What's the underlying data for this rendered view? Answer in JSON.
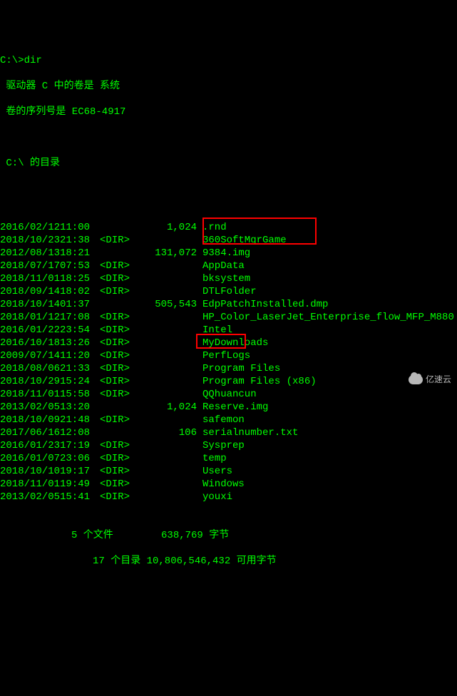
{
  "prompt": "C:\\>dir",
  "volume_line": " 驱动器 C 中的卷是 系统",
  "serial_line": " 卷的序列号是 EC68-4917",
  "dir_of_line": " C:\\ 的目录",
  "entries": [
    {
      "date": "2016/02/12",
      "time": "11:00",
      "dir": "",
      "size": "1,024",
      "name": ".rnd"
    },
    {
      "date": "2018/10/23",
      "time": "21:38",
      "dir": "<DIR>",
      "size": "",
      "name": "360SoftMgrGame"
    },
    {
      "date": "2012/08/13",
      "time": "18:21",
      "dir": "",
      "size": "131,072",
      "name": "9384.img"
    },
    {
      "date": "2018/07/17",
      "time": "07:53",
      "dir": "<DIR>",
      "size": "",
      "name": "AppData"
    },
    {
      "date": "2018/11/01",
      "time": "18:25",
      "dir": "<DIR>",
      "size": "",
      "name": "bksystem"
    },
    {
      "date": "2018/09/14",
      "time": "18:02",
      "dir": "<DIR>",
      "size": "",
      "name": "DTLFolder"
    },
    {
      "date": "2018/10/14",
      "time": "01:37",
      "dir": "",
      "size": "505,543",
      "name": "EdpPatchInstalled.dmp"
    },
    {
      "date": "2018/01/12",
      "time": "17:08",
      "dir": "<DIR>",
      "size": "",
      "name": "HP_Color_LaserJet_Enterprise_flow_MFP_M880"
    },
    {
      "date": "2016/01/22",
      "time": "23:54",
      "dir": "<DIR>",
      "size": "",
      "name": "Intel"
    },
    {
      "date": "2016/10/18",
      "time": "13:26",
      "dir": "<DIR>",
      "size": "",
      "name": "MyDownloads"
    },
    {
      "date": "2009/07/14",
      "time": "11:20",
      "dir": "<DIR>",
      "size": "",
      "name": "PerfLogs"
    },
    {
      "date": "2018/08/06",
      "time": "21:33",
      "dir": "<DIR>",
      "size": "",
      "name": "Program Files"
    },
    {
      "date": "2018/10/29",
      "time": "15:24",
      "dir": "<DIR>",
      "size": "",
      "name": "Program Files (x86)"
    },
    {
      "date": "2018/11/01",
      "time": "15:58",
      "dir": "<DIR>",
      "size": "",
      "name": "QQhuancun"
    },
    {
      "date": "2013/02/05",
      "time": "13:20",
      "dir": "",
      "size": "1,024",
      "name": "Reserve.img"
    },
    {
      "date": "2018/10/09",
      "time": "21:48",
      "dir": "<DIR>",
      "size": "",
      "name": "safemon"
    },
    {
      "date": "2017/06/16",
      "time": "12:08",
      "dir": "",
      "size": "106",
      "name": "serialnumber.txt"
    },
    {
      "date": "2016/01/23",
      "time": "17:19",
      "dir": "<DIR>",
      "size": "",
      "name": "Sysprep"
    },
    {
      "date": "2016/01/07",
      "time": "23:06",
      "dir": "<DIR>",
      "size": "",
      "name": "temp"
    },
    {
      "date": "2018/10/10",
      "time": "19:17",
      "dir": "<DIR>",
      "size": "",
      "name": "Users"
    },
    {
      "date": "2018/11/01",
      "time": "19:49",
      "dir": "<DIR>",
      "size": "",
      "name": "Windows"
    },
    {
      "date": "2013/02/05",
      "time": "15:41",
      "dir": "<DIR>",
      "size": "",
      "name": "youxi"
    }
  ],
  "summary1": "5 个文件        638,769 字节",
  "summary2": "17 个目录 10,806,546,432 可用字节",
  "watermark": "亿速云"
}
